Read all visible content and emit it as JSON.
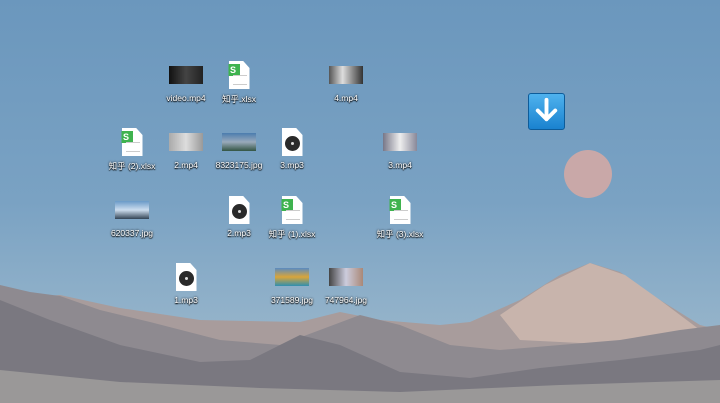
{
  "desktop": {
    "icons": [
      {
        "label": "video.mp4",
        "type": "video"
      },
      {
        "label": "知乎.xlsx",
        "type": "xlsx"
      },
      {
        "label": "4.mp4",
        "type": "video"
      },
      {
        "label": "知乎 (2).xlsx",
        "type": "xlsx"
      },
      {
        "label": "2.mp4",
        "type": "video"
      },
      {
        "label": "8323175.jpg",
        "type": "image"
      },
      {
        "label": "3.mp3",
        "type": "audio"
      },
      {
        "label": "3.mp4",
        "type": "video"
      },
      {
        "label": "620337.jpg",
        "type": "image"
      },
      {
        "label": "2.mp3",
        "type": "audio"
      },
      {
        "label": "知乎 (1).xlsx",
        "type": "xlsx"
      },
      {
        "label": "知乎 (3).xlsx",
        "type": "xlsx"
      },
      {
        "label": "1.mp3",
        "type": "audio"
      },
      {
        "label": "371589.jpg",
        "type": "image"
      },
      {
        "label": "747964.jpg",
        "type": "image"
      }
    ],
    "download_icon": "download-arrow-icon",
    "xlsx_badge": "S"
  }
}
